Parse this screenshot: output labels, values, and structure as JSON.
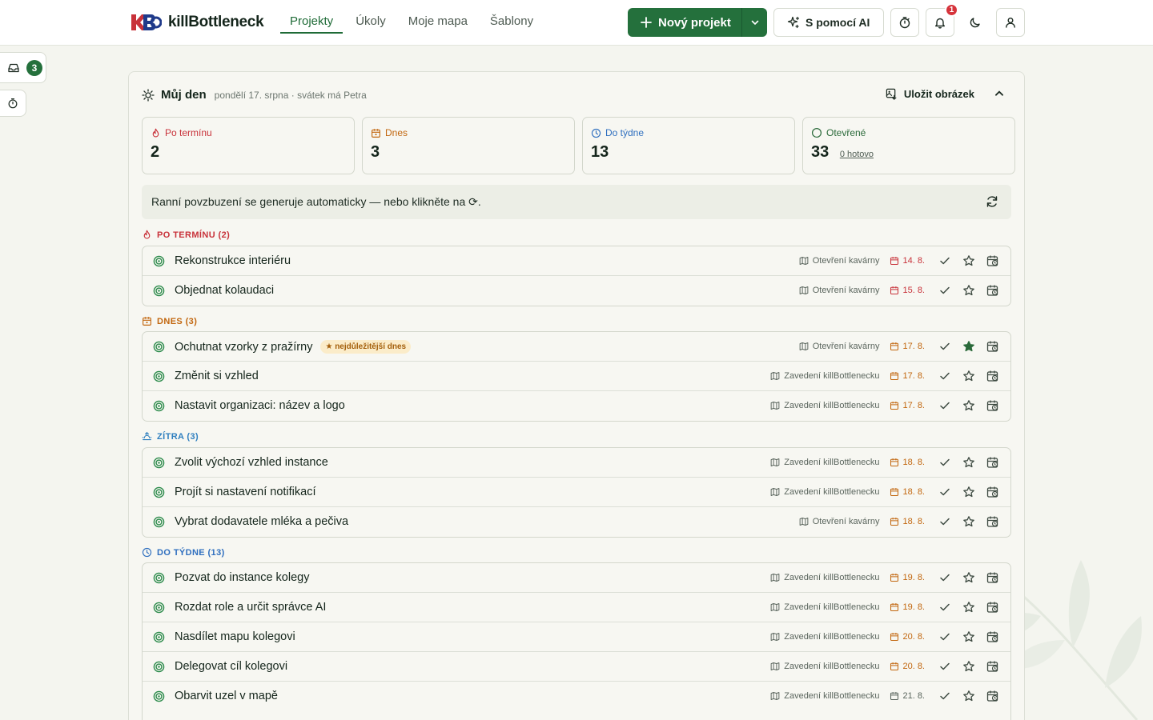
{
  "brand": {
    "name": "killBottleneck"
  },
  "nav": [
    {
      "label": "Projekty",
      "active": true
    },
    {
      "label": "Úkoly",
      "active": false
    },
    {
      "label": "Moje mapa",
      "active": false
    },
    {
      "label": "Šablony",
      "active": false
    }
  ],
  "toolbar": {
    "new_project": "Nový projekt",
    "ai": "S pomocí AI",
    "notification_count": "1"
  },
  "sidebar": {
    "inbox_count": "3"
  },
  "myday": {
    "title": "Můj den",
    "subtitle": "pondělí 17. srpna · svátek má Petra",
    "save_image": "Uložit obrázek"
  },
  "stats": {
    "overdue": {
      "label": "Po termínu",
      "value": "2"
    },
    "today": {
      "label": "Dnes",
      "value": "3"
    },
    "week": {
      "label": "Do týdne",
      "value": "13"
    },
    "open": {
      "label": "Otevřené",
      "value": "33",
      "done": "0 hotovo"
    }
  },
  "banner": {
    "text": "Ranní povzbuzení se generuje automaticky — nebo klikněte na ⟳."
  },
  "sections": {
    "overdue": {
      "heading": "PO TERMÍNU (2)"
    },
    "today": {
      "heading": "DNES (3)"
    },
    "tomorrow": {
      "heading": "ZÍTRA (3)"
    },
    "week": {
      "heading": "DO TÝDNE (13)"
    }
  },
  "tasks": {
    "overdue": [
      {
        "title": "Rekonstrukce interiéru",
        "project": "Otevření kavárny",
        "date": "14. 8."
      },
      {
        "title": "Objednat kolaudaci",
        "project": "Otevření kavárny",
        "date": "15. 8."
      }
    ],
    "today": [
      {
        "title": "Ochutnat vzorky z pražírny",
        "badge": "★ nejdůležitější dnes",
        "project": "Otevření kavárny",
        "date": "17. 8."
      },
      {
        "title": "Změnit si vzhled",
        "project": "Zavedení killBottlenecku",
        "date": "17. 8."
      },
      {
        "title": "Nastavit organizaci: název a logo",
        "project": "Zavedení killBottlenecku",
        "date": "17. 8."
      }
    ],
    "tomorrow": [
      {
        "title": "Zvolit výchozí vzhled instance",
        "project": "Zavedení killBottlenecku",
        "date": "18. 8."
      },
      {
        "title": "Projít si nastavení notifikací",
        "project": "Zavedení killBottlenecku",
        "date": "18. 8."
      },
      {
        "title": "Vybrat dodavatele mléka a pečiva",
        "project": "Otevření kavárny",
        "date": "18. 8."
      }
    ],
    "week": [
      {
        "title": "Pozvat do instance kolegy",
        "project": "Zavedení killBottlenecku",
        "date": "19. 8."
      },
      {
        "title": "Rozdat role a určit správce AI",
        "project": "Zavedení killBottlenecku",
        "date": "19. 8."
      },
      {
        "title": "Nasdílet mapu kolegovi",
        "project": "Zavedení killBottlenecku",
        "date": "20. 8."
      },
      {
        "title": "Delegovat cíl kolegovi",
        "project": "Zavedení killBottlenecku",
        "date": "20. 8."
      },
      {
        "title": "Obarvit uzel v mapě",
        "project": "Zavedení killBottlenecku",
        "date": "21. 8."
      }
    ]
  },
  "colors": {
    "brand_green": "#24703c",
    "overdue_red": "#c8323a",
    "today_orange": "#c2670f",
    "tomorrow_blue": "#2f7fbf",
    "week_blue": "#2f6fbf",
    "open_green": "#2b6a3a"
  },
  "icons": {
    "target": "target-icon",
    "map": "map-icon",
    "calendar": "calendar-icon",
    "check": "check-icon",
    "star": "star-icon",
    "reschedule": "calendar-clock-icon"
  }
}
